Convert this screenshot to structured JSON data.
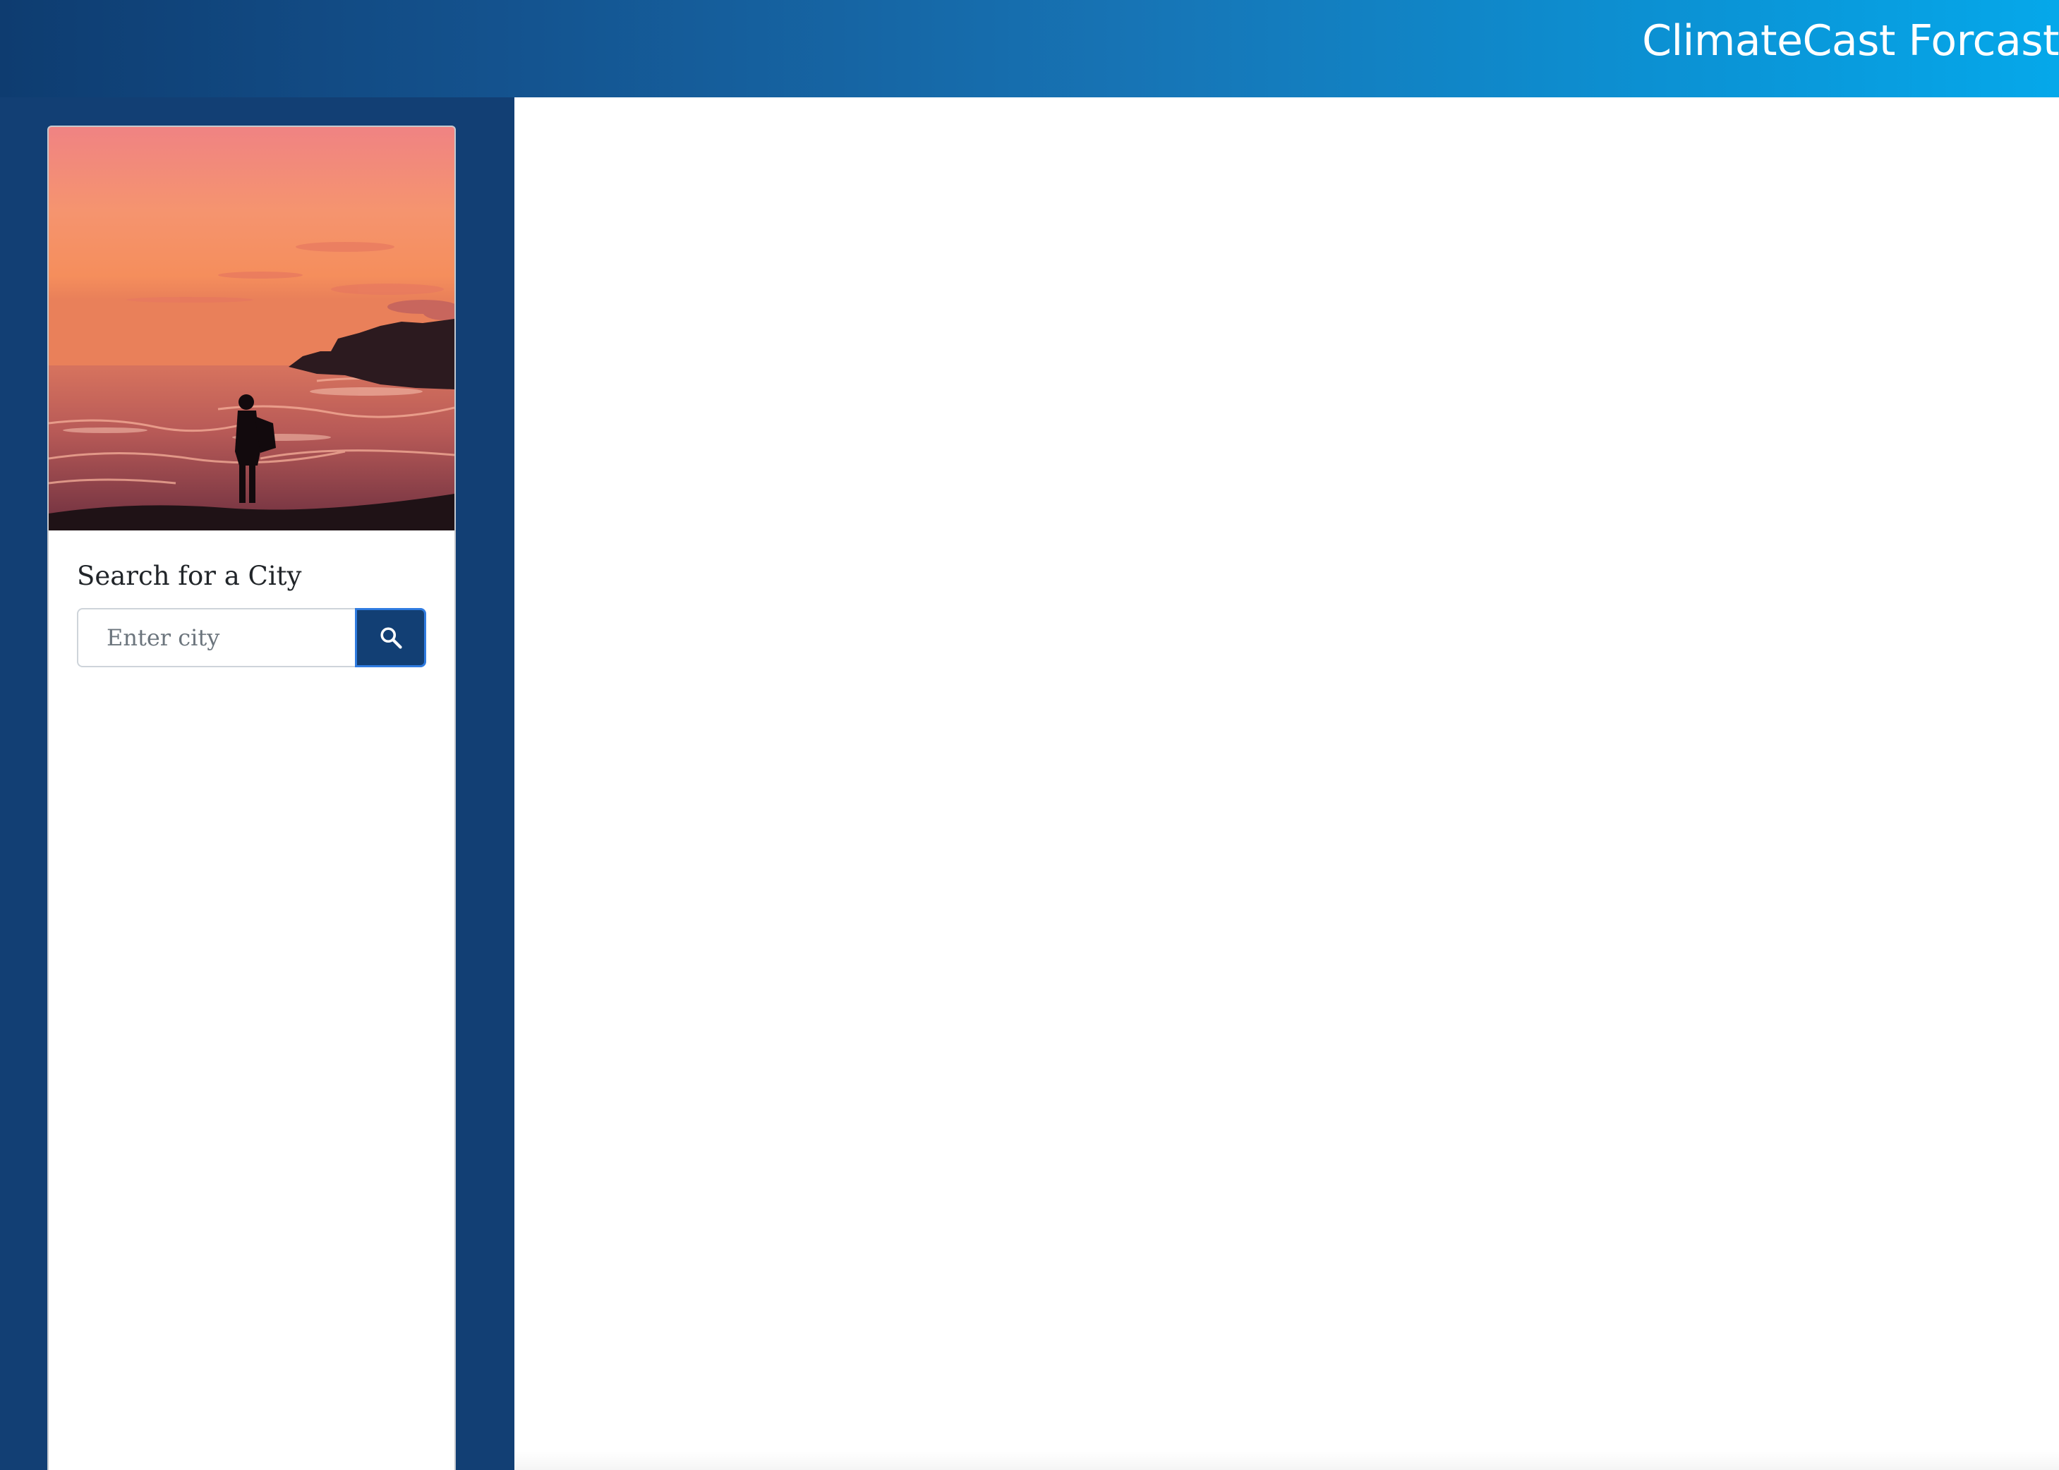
{
  "header": {
    "title": "ClimateCast Forcast"
  },
  "sidebar": {
    "card": {
      "image": "sunset-ocean-silhouette-photo",
      "search": {
        "heading": "Search for a City",
        "input_placeholder": "Enter city",
        "input_value": "",
        "button_icon": "search-icon"
      }
    }
  },
  "colors": {
    "header_gradient_start": "#0e3c70",
    "header_gradient_end": "#05a8ea",
    "sidebar_bg": "#123f74",
    "button_bg": "#123f74",
    "button_border": "#2f7be0"
  }
}
